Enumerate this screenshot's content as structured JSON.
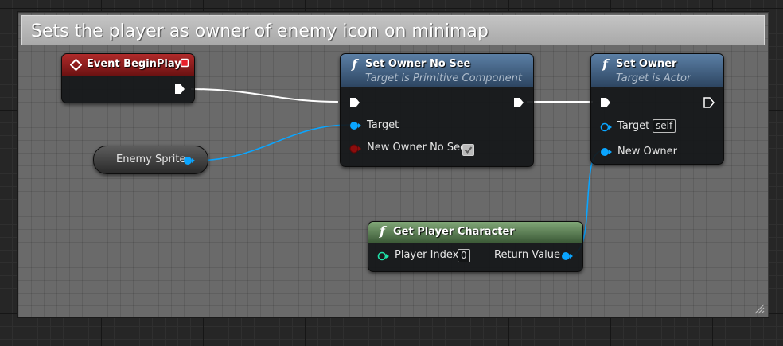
{
  "comment": {
    "title": "Sets the player as owner of enemy icon on minimap"
  },
  "nodes": {
    "event_begin_play": {
      "title": "Event BeginPlay"
    },
    "enemy_sprite": {
      "title": "Enemy Sprite"
    },
    "set_owner_no_see": {
      "title": "Set Owner No See",
      "subtitle": "Target is Primitive Component",
      "pins": {
        "target": "Target",
        "new_owner_no_see": "New Owner No See"
      }
    },
    "set_owner": {
      "title": "Set Owner",
      "subtitle": "Target is Actor",
      "pins": {
        "target": "Target",
        "target_default": "self",
        "new_owner": "New Owner"
      }
    },
    "get_player_character": {
      "title": "Get Player Character",
      "pins": {
        "player_index": "Player Index",
        "player_index_value": "0",
        "return_value": "Return Value"
      }
    }
  },
  "colors": {
    "exec_wire": "#ffffff",
    "object_pin": "#0aa5ff",
    "bool_pin": "#8c0d0d",
    "event_header": "#a02020",
    "function_header": "#4a6e92",
    "pure_header": "#6f9866",
    "comment_header": "#b6b6b6"
  }
}
